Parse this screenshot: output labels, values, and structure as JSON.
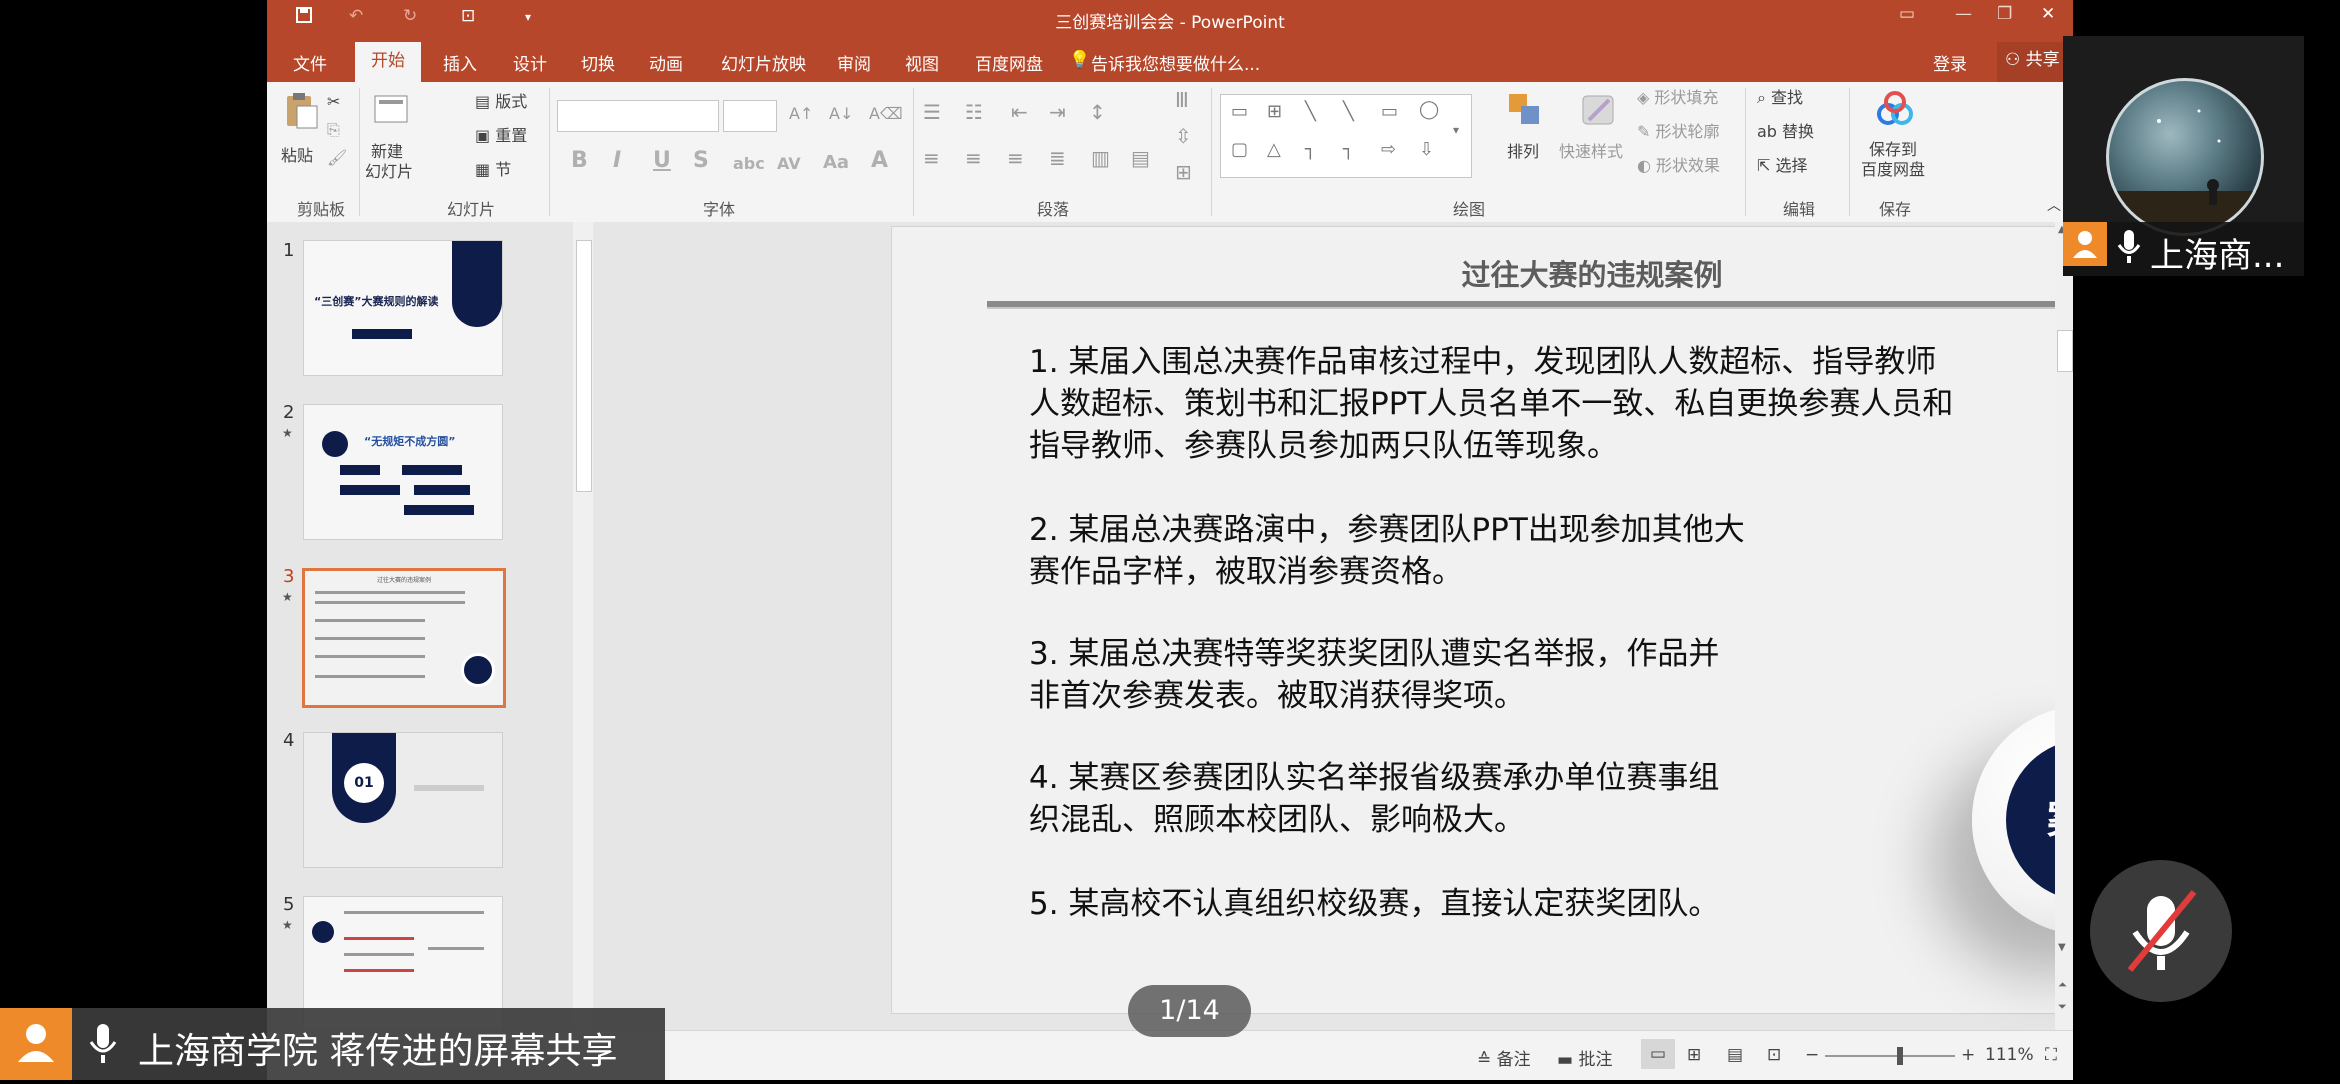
{
  "window": {
    "title": "三创赛培训会会 - PowerPoint",
    "ribbon_tabs": [
      "文件",
      "开始",
      "插入",
      "设计",
      "切换",
      "动画",
      "幻灯片放映",
      "审阅",
      "视图",
      "百度网盘"
    ],
    "tell_me": "告诉我您想要做什么...",
    "login": "登录",
    "share": "共享"
  },
  "ribbon": {
    "clipboard": {
      "paste": "粘贴",
      "label": "剪贴板"
    },
    "slides": {
      "new_slide": "新建",
      "new_slide_2": "幻灯片",
      "layout": "版式",
      "reset": "重置",
      "section": "节",
      "label": "幻灯片"
    },
    "font": {
      "label": "字体"
    },
    "paragraph": {
      "label": "段落"
    },
    "drawing": {
      "arrange": "排列",
      "quick_styles": "快速样式",
      "shape_fill": "形状填充",
      "shape_outline": "形状轮廓",
      "shape_effects": "形状效果",
      "label": "绘图"
    },
    "editing": {
      "find": "查找",
      "replace": "替换",
      "select": "选择",
      "label": "编辑"
    },
    "save": {
      "save_to_baidu": "保存到",
      "save_to_baidu_2": "百度网盘",
      "label": "保存"
    }
  },
  "thumbnails": [
    {
      "num": "1",
      "star": false,
      "title": "“三创赛”大赛规则的解读"
    },
    {
      "num": "2",
      "star": true,
      "title": "“无规矩不成方圆”"
    },
    {
      "num": "3",
      "star": true,
      "title": "过往大赛的违规案例"
    },
    {
      "num": "4",
      "star": false,
      "title": "01"
    },
    {
      "num": "5",
      "star": true,
      "title": ""
    }
  ],
  "slide": {
    "title": "过往大赛的违规案例",
    "items": [
      [
        "1. 某届入围总决赛作品审核过程中，发现团队人数超标、指导教师",
        "人数超标、策划书和汇报PPT人员名单不一致、私自更换参赛人员和",
        "指导教师、参赛队员参加两只队伍等现象。"
      ],
      [
        "2. 某届总决赛路演中，参赛团队PPT出现参加其他大",
        "赛作品字样，被取消参赛资格。"
      ],
      [
        "3. 某届总决赛特等奖获奖团队遭实名举报，作品并",
        "非首次参赛发表。被取消获得奖项。"
      ],
      [
        "4. 某赛区参赛团队实名举报省级赛承办单位赛事组",
        "织混乱、照顾本校团队、影响极大。"
      ],
      [
        "5. 某高校不认真组织校级赛，直接认定获奖团队。"
      ]
    ],
    "badge": "案例"
  },
  "page_counter": "1/14",
  "statusbar": {
    "notes": "备注",
    "comments": "批注",
    "zoom": "111%"
  },
  "meeting": {
    "share_banner": "上海商学院 蒋传进的屏幕共享",
    "participant_name": "上海商..."
  }
}
